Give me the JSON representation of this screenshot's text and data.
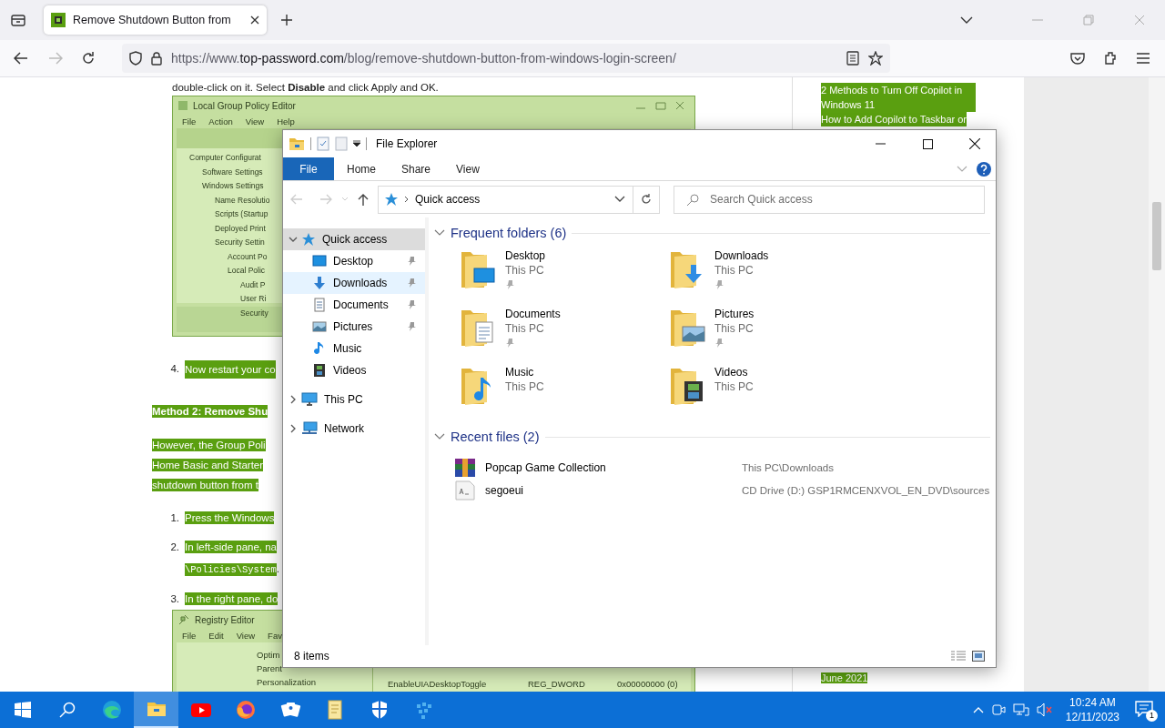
{
  "browser": {
    "tab": {
      "title": "Remove Shutdown Button from"
    },
    "url": {
      "scheme": "https://www.",
      "domain": "top-password.com",
      "path": "/blog/remove-shutdown-button-from-windows-login-screen/"
    }
  },
  "article": {
    "intro": "double-click on it. Select **Disable** and click Apply and OK.",
    "policy_editor": {
      "title": "Local Group Policy Editor",
      "menu": [
        "File",
        "Action",
        "View",
        "Help"
      ],
      "tree": [
        {
          "label": "Computer Configurat",
          "children": [
            {
              "label": "Software Settings"
            },
            {
              "label": "Windows Settings",
              "children": [
                {
                  "label": "Name Resolutio"
                },
                {
                  "label": "Scripts (Startup"
                },
                {
                  "label": "Deployed Print"
                },
                {
                  "label": "Security Settin",
                  "children": [
                    {
                      "label": "Account Po"
                    },
                    {
                      "label": "Local Polic",
                      "children": [
                        {
                          "label": "Audit P"
                        },
                        {
                          "label": "User Ri"
                        },
                        {
                          "label": "Security"
                        }
                      ]
                    }
                  ]
                }
              ]
            }
          ]
        }
      ]
    },
    "step_4": {
      "number": "4.",
      "text": "Now restart your co"
    },
    "heading": "Method 2: Remove Shu",
    "paragraph": [
      "However, the Group Poli",
      "Home Basic and Starter",
      "shutdown button from t"
    ],
    "steps": [
      {
        "number": "1.",
        "text": "Press the Windows"
      },
      {
        "number": "2.",
        "text": "In left-side pane, na",
        "code": "\\Policies\\System",
        "after": "."
      },
      {
        "number": "3.",
        "text": "In the right pane, do"
      }
    ],
    "registry_editor": {
      "title": "Registry Editor",
      "menu": [
        "File",
        "Edit",
        "View",
        "Fav"
      ],
      "tree": [
        "Optim",
        "Parent",
        "Personalization"
      ],
      "values": [
        {
          "name": "EnableUIADesktopToggle",
          "type": "REG_DWORD",
          "data": "0x00000000 (0)"
        }
      ]
    }
  },
  "sidebar": {
    "links": [
      "2 Methods to Turn Off Copilot in Windows 11",
      "How to Add Copilot to Taskbar or"
    ],
    "archives": [
      "June 2021"
    ]
  },
  "explorer": {
    "title": "File Explorer",
    "ribbon_tabs": [
      {
        "label": "File",
        "kind": "file"
      },
      {
        "label": "Home",
        "kind": "tab"
      },
      {
        "label": "Share",
        "kind": "tab"
      },
      {
        "label": "View",
        "kind": "tab"
      }
    ],
    "address": {
      "location": "Quick access"
    },
    "search": {
      "placeholder": "Search Quick access"
    },
    "nav": [
      {
        "label": "Quick access",
        "kind": "star",
        "expanded": true,
        "selected": true,
        "hovered": false,
        "children": [
          {
            "label": "Desktop",
            "kind": "desktop",
            "pinned": true,
            "selected": false,
            "hovered": false
          },
          {
            "label": "Downloads",
            "kind": "downloads",
            "pinned": true,
            "selected": false,
            "hovered": true
          },
          {
            "label": "Documents",
            "kind": "documents",
            "pinned": true,
            "selected": false,
            "hovered": false
          },
          {
            "label": "Pictures",
            "kind": "pictures",
            "pinned": true,
            "selected": false,
            "hovered": false
          },
          {
            "label": "Music",
            "kind": "music",
            "pinned": false,
            "selected": false,
            "hovered": false
          },
          {
            "label": "Videos",
            "kind": "videos",
            "pinned": false,
            "selected": false,
            "hovered": false
          }
        ]
      },
      {
        "label": "This PC",
        "kind": "pc",
        "expanded": false,
        "selected": false,
        "hovered": false
      },
      {
        "label": "Network",
        "kind": "network",
        "expanded": false,
        "selected": false,
        "hovered": false
      }
    ],
    "frequent_folders": {
      "title": "Frequent folders (6)",
      "items": [
        {
          "name": "Desktop",
          "location": "This PC",
          "kind": "desktop",
          "pinned": true
        },
        {
          "name": "Downloads",
          "location": "This PC",
          "kind": "downloads",
          "pinned": true
        },
        {
          "name": "Documents",
          "location": "This PC",
          "kind": "documents",
          "pinned": true
        },
        {
          "name": "Pictures",
          "location": "This PC",
          "kind": "pictures",
          "pinned": true
        },
        {
          "name": "Music",
          "location": "This PC",
          "kind": "music",
          "pinned": false
        },
        {
          "name": "Videos",
          "location": "This PC",
          "kind": "videos",
          "pinned": false
        }
      ]
    },
    "recent_files": {
      "title": "Recent files (2)",
      "items": [
        {
          "name": "Popcap Game Collection",
          "path": "This PC\\Downloads",
          "kind": "archive"
        },
        {
          "name": "segoeui",
          "path": "CD Drive (D:) GSP1RMCENXVOL_EN_DVD\\sources",
          "kind": "font"
        }
      ]
    },
    "status": "8 items"
  },
  "taskbar": {
    "apps": [
      {
        "kind": "edge",
        "active": false
      },
      {
        "kind": "explorer",
        "active": true
      },
      {
        "kind": "youtube",
        "active": false
      },
      {
        "kind": "firefox",
        "active": false
      },
      {
        "kind": "cards",
        "active": false
      },
      {
        "kind": "notepad",
        "active": false
      },
      {
        "kind": "shield",
        "active": false
      },
      {
        "kind": "grid",
        "active": false
      }
    ],
    "time": "10:24 AM",
    "date": "12/11/2023",
    "notifications": "1"
  }
}
